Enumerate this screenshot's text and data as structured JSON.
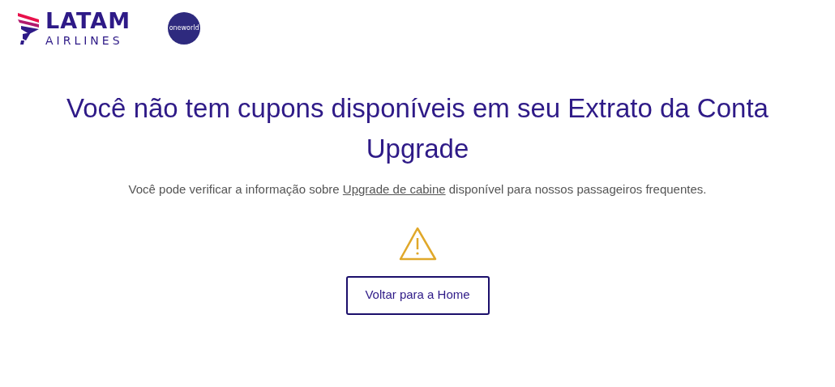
{
  "header": {
    "logo": {
      "brand": "LATAM",
      "sub": "AIRLINES"
    },
    "alliance": "oneworld"
  },
  "message": {
    "title": "Você não tem cupons disponíveis em seu Extrato da Conta Upgrade",
    "text_before": "Você pode verificar a informação sobre",
    "link": "Upgrade de cabine",
    "text_after": "disponível para nossos passageiros frequentes."
  },
  "button": "Voltar para a Home"
}
